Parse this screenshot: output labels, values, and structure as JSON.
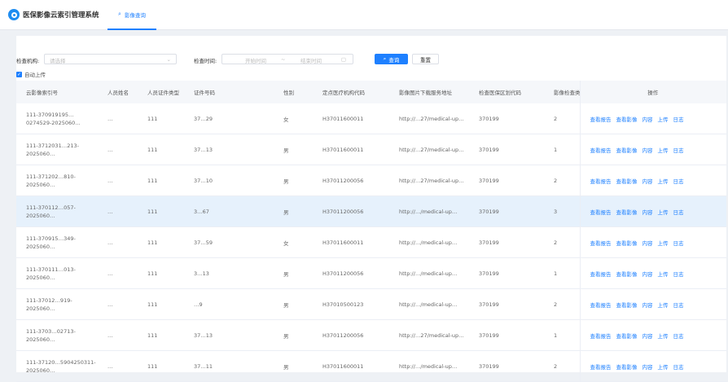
{
  "app": {
    "title": "医保影像云索引管理系统"
  },
  "tabs": [
    {
      "label": "影像查询",
      "icon": "search-icon"
    }
  ],
  "filters": {
    "org_label": "检查机构:",
    "org_placeholder": "请选择",
    "time_label": "检查时间:",
    "start_placeholder": "开始时间",
    "range_sep": "~",
    "end_placeholder": "结束时间",
    "query_label": "查询",
    "reset_label": "重置",
    "auto_upload_label": "自动上传",
    "auto_upload_checked": true
  },
  "columns": [
    "云影像索引号",
    "人员姓名",
    "人员证件类型",
    "证件号码",
    "性别",
    "定点医疗机构代码",
    "影像图片下载服务地址",
    "检查医保区划代码",
    "影像检查类型",
    "操作"
  ],
  "actions": [
    "查看报告",
    "查看影像",
    "内容",
    "上传",
    "日志"
  ],
  "rows": [
    {
      "index_no": "111-370919195…0274529-2025060…",
      "name": "…",
      "id_type": "111",
      "id_no": "37…29",
      "gender": "女",
      "org_code": "H37011600011",
      "url": "http://…27/medical-up…",
      "region": "370199",
      "exam_type": "2"
    },
    {
      "index_no": "111-3712031…213-2025060…",
      "name": "…",
      "id_type": "111",
      "id_no": "37…13",
      "gender": "男",
      "org_code": "H37011600011",
      "url": "http://…27/medical-up…",
      "region": "370199",
      "exam_type": "1"
    },
    {
      "index_no": "111-371202…810-2025060…",
      "name": "…",
      "id_type": "111",
      "id_no": "37…10",
      "gender": "男",
      "org_code": "H37011200056",
      "url": "http://…27/medical-up…",
      "region": "370199",
      "exam_type": "2"
    },
    {
      "index_no": "111-370112…057-2025060…",
      "name": "…",
      "id_type": "111",
      "id_no": "3…67",
      "gender": "男",
      "org_code": "H37011200056",
      "url": "http://…/medical-up…",
      "region": "370199",
      "exam_type": "3"
    },
    {
      "index_no": "111-370915…349-2025060…",
      "name": "…",
      "id_type": "111",
      "id_no": "37…59",
      "gender": "女",
      "org_code": "H37011600011",
      "url": "http://…/medical-up…",
      "region": "370199",
      "exam_type": "2"
    },
    {
      "index_no": "111-370111…013-2025060…",
      "name": "…",
      "id_type": "111",
      "id_no": "3…13",
      "gender": "男",
      "org_code": "H37011200056",
      "url": "http://…/medical-up…",
      "region": "370199",
      "exam_type": "1"
    },
    {
      "index_no": "111-37012…919-2025060…",
      "name": "…",
      "id_type": "111",
      "id_no": "…9",
      "gender": "男",
      "org_code": "H37010500123",
      "url": "http://…/medical-up…",
      "region": "370199",
      "exam_type": "2"
    },
    {
      "index_no": "111-3703…02713-2025060…",
      "name": "…",
      "id_type": "111",
      "id_no": "37…13",
      "gender": "男",
      "org_code": "H37011200056",
      "url": "http://…27/medical-up…",
      "region": "370199",
      "exam_type": "1"
    },
    {
      "index_no": "111-37120…5904250311-2025060…",
      "name": "…",
      "id_type": "111",
      "id_no": "37…11",
      "gender": "男",
      "org_code": "H37011600011",
      "url": "http://…/medical-up…",
      "region": "370199",
      "exam_type": "2"
    }
  ],
  "selected_row": 3
}
